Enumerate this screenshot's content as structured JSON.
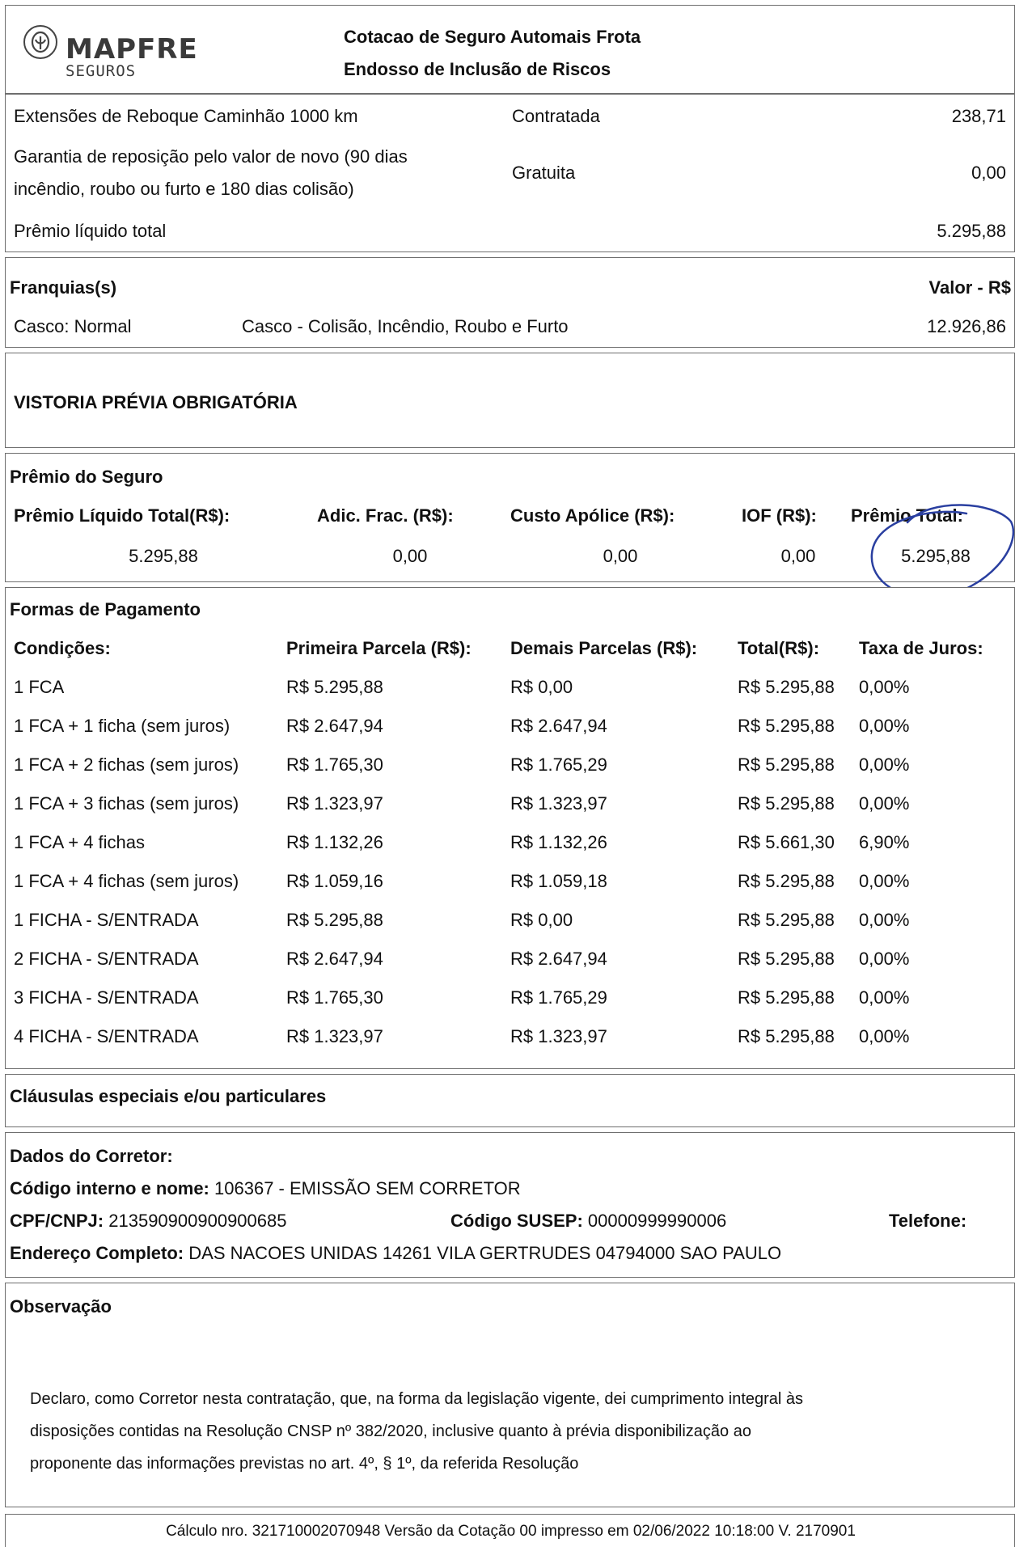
{
  "header": {
    "logo_brand": "MAPFRE",
    "logo_sub": "SEGUROS",
    "title": "Cotacao de Seguro Automais Frota",
    "subtitle": "Endosso de Inclusão de Riscos"
  },
  "coverages": [
    {
      "name": "Extensões de Reboque Caminhão 1000 km",
      "status": "Contratada",
      "value": "238,71"
    },
    {
      "name_line1": "Garantia de reposição pelo valor de novo (90 dias",
      "name_line2": "incêndio, roubo ou furto e 180 dias colisão)",
      "status": "Gratuita",
      "value": "0,00"
    },
    {
      "name": "Prêmio líquido total",
      "value": "5.295,88"
    }
  ],
  "franquias": {
    "title": "Franquias(s)",
    "value_header": "Valor - R$",
    "item_type": "Casco: Normal",
    "item_desc": "Casco - Colisão, Incêndio, Roubo e Furto",
    "item_value": "12.926,86"
  },
  "vistoria": "VISTORIA PRÉVIA OBRIGATÓRIA",
  "premio": {
    "title": "Prêmio do Seguro",
    "headers": [
      "Prêmio Líquido Total(R$):",
      "Adic. Frac. (R$):",
      "Custo Apólice (R$):",
      "IOF (R$):",
      "Prêmio Total:"
    ],
    "values": [
      "5.295,88",
      "0,00",
      "0,00",
      "0,00",
      "5.295,88"
    ]
  },
  "pagamento": {
    "title": "Formas de Pagamento",
    "headers": [
      "Condições:",
      "Primeira Parcela (R$):",
      "Demais Parcelas (R$):",
      "Total(R$):",
      "Taxa de Juros:"
    ],
    "rows": [
      [
        "1 FCA",
        "R$ 5.295,88",
        "R$ 0,00",
        "R$ 5.295,88",
        "0,00%"
      ],
      [
        "1 FCA + 1 ficha (sem juros)",
        "R$ 2.647,94",
        "R$ 2.647,94",
        "R$ 5.295,88",
        "0,00%"
      ],
      [
        "1 FCA + 2 fichas (sem juros)",
        "R$ 1.765,30",
        "R$ 1.765,29",
        "R$ 5.295,88",
        "0,00%"
      ],
      [
        "1 FCA + 3 fichas (sem juros)",
        "R$ 1.323,97",
        "R$ 1.323,97",
        "R$ 5.295,88",
        "0,00%"
      ],
      [
        "1 FCA + 4 fichas",
        "R$ 1.132,26",
        "R$ 1.132,26",
        "R$ 5.661,30",
        "6,90%"
      ],
      [
        "1 FCA + 4 fichas (sem juros)",
        "R$ 1.059,16",
        "R$ 1.059,18",
        "R$ 5.295,88",
        "0,00%"
      ],
      [
        "1 FICHA - S/ENTRADA",
        "R$ 5.295,88",
        "R$ 0,00",
        "R$ 5.295,88",
        "0,00%"
      ],
      [
        "2 FICHA - S/ENTRADA",
        "R$ 2.647,94",
        "R$ 2.647,94",
        "R$ 5.295,88",
        "0,00%"
      ],
      [
        "3 FICHA - S/ENTRADA",
        "R$ 1.765,30",
        "R$ 1.765,29",
        "R$ 5.295,88",
        "0,00%"
      ],
      [
        "4 FICHA - S/ENTRADA",
        "R$ 1.323,97",
        "R$ 1.323,97",
        "R$ 5.295,88",
        "0,00%"
      ]
    ]
  },
  "clausulas": "Cláusulas especiais e/ou particulares",
  "corretor": {
    "title": "Dados do Corretor:",
    "codigo_label": "Código interno e nome:",
    "codigo_value": "106367 - EMISSÃO SEM CORRETOR",
    "cpf_label": "CPF/CNPJ:",
    "cpf_value": "213590900900900685",
    "susep_label": "Código SUSEP:",
    "susep_value": "00000999990006",
    "telefone_label": "Telefone:",
    "endereco_label": "Endereço Completo:",
    "endereco_value": "DAS NACOES UNIDAS 14261 VILA GERTRUDES 04794000 SAO PAULO"
  },
  "observacao": {
    "title": "Observação",
    "line1": "Declaro, como Corretor nesta contratação, que, na forma da legislação vigente, dei cumprimento integral às",
    "line2": "disposições contidas na Resolução CNSP nº 382/2020, inclusive quanto à prévia disponibilização ao",
    "line3": "proponente das informações previstas no art. 4º, § 1º, da referida Resolução"
  },
  "footer": "Cálculo nro. 321710002070948 Versão da Cotação 00 impresso em 02/06/2022 10:18:00 V. 2170901",
  "colors": {
    "border": "#6e6e6e",
    "pen": "#2a3fa0"
  }
}
